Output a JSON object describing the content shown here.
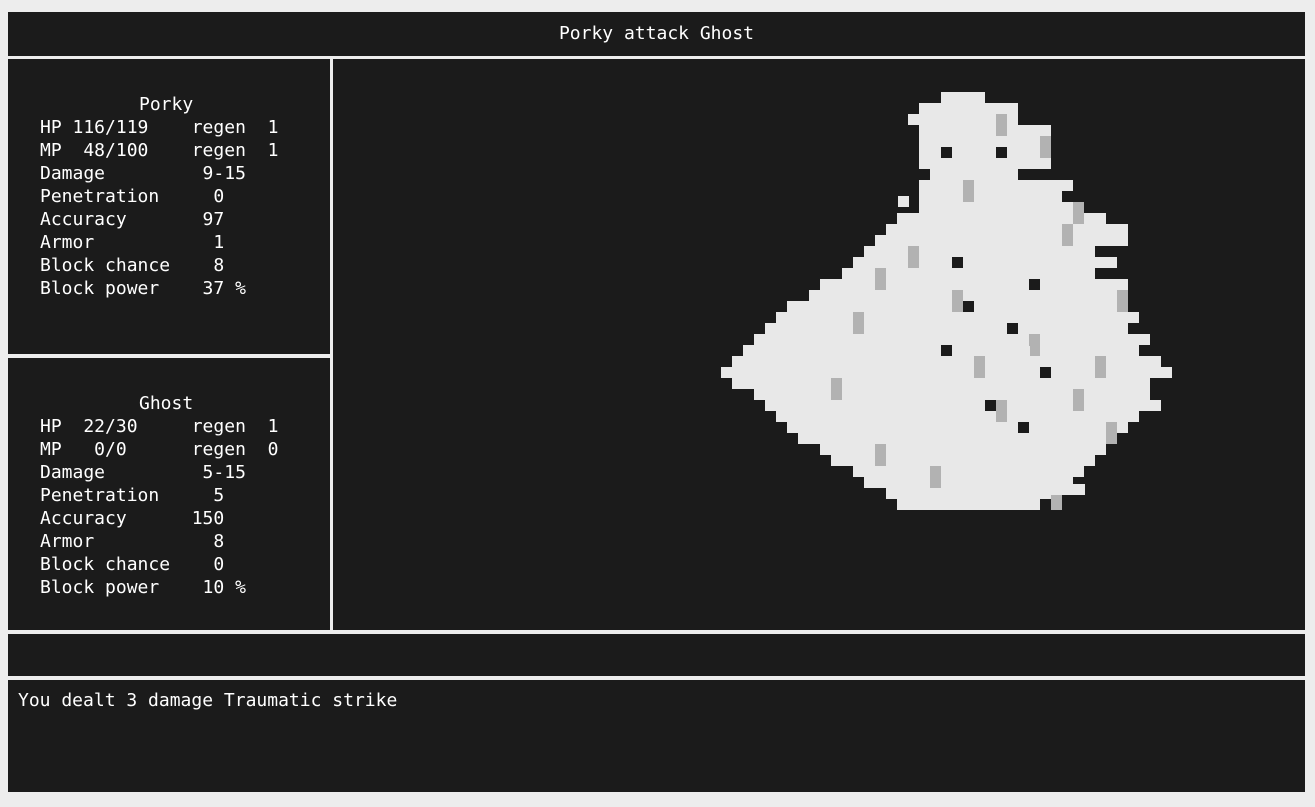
{
  "title": "Porky attack Ghost",
  "player": {
    "name": "Porky",
    "lines": [
      "HP 116/119    regen  1",
      "MP  48/100    regen  1",
      "Damage         9-15",
      "Penetration     0",
      "Accuracy       97",
      "Armor           1",
      "Block chance    8",
      "Block power    37 %"
    ]
  },
  "enemy": {
    "name": "Ghost",
    "lines": [
      "HP  22/30     regen  1",
      "MP   0/0      regen  0",
      "Damage         5-15",
      "Penetration     5",
      "Accuracy      150",
      "Armor           8",
      "Block chance    0",
      "Block power    10 %"
    ]
  },
  "log": {
    "message": "You dealt 3 damage Traumatic strike"
  },
  "colors": {
    "panel": "#1b1b1b",
    "frame": "#ededed",
    "sprite_light": "#e8e8e8",
    "sprite_shade": "#b2b2b2"
  },
  "sprite_icon": "ghost-pixel-art"
}
